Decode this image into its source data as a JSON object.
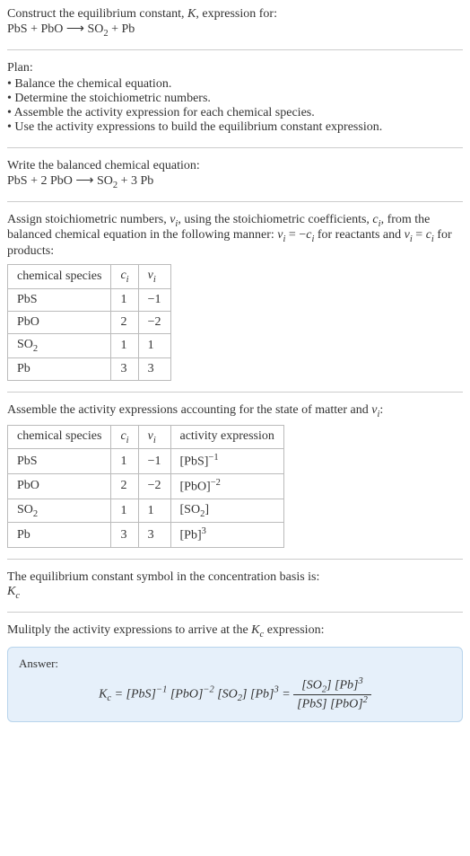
{
  "intro": {
    "line1": "Construct the equilibrium constant, ",
    "k": "K",
    "line1b": ", expression for:",
    "reaction_lhs": "PbS + PbO",
    "arrow": "⟶",
    "reaction_rhs_so2": "SO",
    "reaction_rhs_so2_sub": "2",
    "reaction_rhs_plus_pb": " + Pb"
  },
  "plan": {
    "heading": "Plan:",
    "items": [
      "Balance the chemical equation.",
      "Determine the stoichiometric numbers.",
      "Assemble the activity expression for each chemical species.",
      "Use the activity expressions to build the equilibrium constant expression."
    ]
  },
  "balanced": {
    "intro": "Write the balanced chemical equation:",
    "lhs": "PbS + 2 PbO",
    "arrow": "⟶",
    "rhs_so2": "SO",
    "rhs_so2_sub": "2",
    "rhs_plus_pb": " + 3 Pb"
  },
  "assign": {
    "text1": "Assign stoichiometric numbers, ",
    "nu": "ν",
    "nu_i": "i",
    "text2": ", using the stoichiometric coefficients, ",
    "c": "c",
    "c_i": "i",
    "text3": ", from the balanced chemical equation in the following manner: ",
    "eq1": "ν",
    "eq1_sub": "i",
    "eq1_eq": " = −",
    "eq1_c": "c",
    "eq1_csub": "i",
    "text4": " for reactants and ",
    "eq2": "ν",
    "eq2_sub": "i",
    "eq2_eq": " = ",
    "eq2_c": "c",
    "eq2_csub": "i",
    "text5": " for products:",
    "table": {
      "h1": "chemical species",
      "h2_c": "c",
      "h2_i": "i",
      "h3_nu": "ν",
      "h3_i": "i",
      "rows": [
        {
          "species": "PbS",
          "c": "1",
          "nu": "−1"
        },
        {
          "species": "PbO",
          "c": "2",
          "nu": "−2"
        },
        {
          "species_a": "SO",
          "species_sub": "2",
          "c": "1",
          "nu": "1"
        },
        {
          "species": "Pb",
          "c": "3",
          "nu": "3"
        }
      ]
    }
  },
  "assemble": {
    "text1": "Assemble the activity expressions accounting for the state of matter and ",
    "nu": "ν",
    "nu_i": "i",
    "text2": ":",
    "table": {
      "h1": "chemical species",
      "h2_c": "c",
      "h2_i": "i",
      "h3_nu": "ν",
      "h3_i": "i",
      "h4": "activity expression",
      "rows": [
        {
          "species": "PbS",
          "c": "1",
          "nu": "−1",
          "act_base": "[PbS]",
          "act_sup": "−1"
        },
        {
          "species": "PbO",
          "c": "2",
          "nu": "−2",
          "act_base": "[PbO]",
          "act_sup": "−2"
        },
        {
          "species_a": "SO",
          "species_sub": "2",
          "c": "1",
          "nu": "1",
          "act_base": "[SO",
          "act_sub_inner": "2",
          "act_close": "]"
        },
        {
          "species": "Pb",
          "c": "3",
          "nu": "3",
          "act_base": "[Pb]",
          "act_sup": "3"
        }
      ]
    }
  },
  "symbol": {
    "text": "The equilibrium constant symbol in the concentration basis is:",
    "kc_k": "K",
    "kc_c": "c"
  },
  "multiply": {
    "text1": "Mulitply the activity expressions to arrive at the ",
    "kc_k": "K",
    "kc_c": "c",
    "text2": " expression:"
  },
  "answer": {
    "label": "Answer:",
    "kc_k": "K",
    "kc_c": "c",
    "eq": " = ",
    "part1": "[PbS]",
    "sup1": "−1",
    "part2": " [PbO]",
    "sup2": "−2",
    "part3": " [SO",
    "part3_sub": "2",
    "part3b": "] [Pb]",
    "sup3": "3",
    "eq2": " = ",
    "num1": "[SO",
    "num1_sub": "2",
    "num1b": "] [Pb]",
    "num_sup": "3",
    "den1": "[PbS] [PbO]",
    "den_sup": "2"
  }
}
